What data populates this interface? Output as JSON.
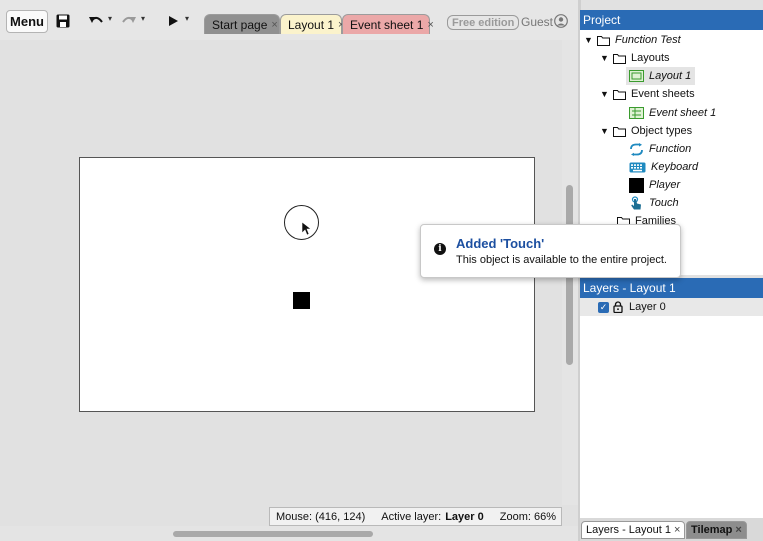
{
  "toolbar": {
    "menu_label": "Menu",
    "tabs": [
      {
        "label": "Start page",
        "close": "×"
      },
      {
        "label": "Layout 1",
        "close": "×"
      },
      {
        "label": "Event sheet 1",
        "close": "×"
      }
    ],
    "free_edition": "Free edition",
    "guest": "Guest",
    "caret": "▾"
  },
  "project": {
    "header": "Project",
    "tree": {
      "root": "Function Test",
      "layouts_folder": "Layouts",
      "layout_item": "Layout 1",
      "event_sheets_folder": "Event sheets",
      "event_sheet_item": "Event sheet 1",
      "object_types_folder": "Object types",
      "objects": [
        "Function",
        "Keyboard",
        "Player",
        "Touch"
      ],
      "families_folder": "Families"
    }
  },
  "layers": {
    "header": "Layers - Layout 1",
    "items": [
      {
        "name": "Layer 0",
        "checked": true
      }
    ]
  },
  "bottom_tabs": [
    {
      "label": "Layers - Layout 1",
      "close": "×"
    },
    {
      "label": "Tilemap",
      "close": "×"
    }
  ],
  "status": {
    "mouse": "Mouse: (416, 124)",
    "active_layer_label": "Active layer:",
    "active_layer_value": "Layer 0",
    "zoom": "Zoom: 66%"
  },
  "notification": {
    "title": "Added 'Touch'",
    "body": "This object is available to the entire project."
  },
  "colors": {
    "accent_blue": "#2a6bb5",
    "layout_tab": "#fbf3cc",
    "event_tab": "#eba8a8",
    "notification_title": "#1c4fa0"
  },
  "icons": [
    "save-icon",
    "undo-icon",
    "redo-icon",
    "play-icon",
    "user-icon",
    "folder-icon",
    "layout-icon",
    "event-sheet-icon",
    "function-icon",
    "keyboard-icon",
    "touch-icon",
    "lock-icon",
    "info-icon"
  ]
}
